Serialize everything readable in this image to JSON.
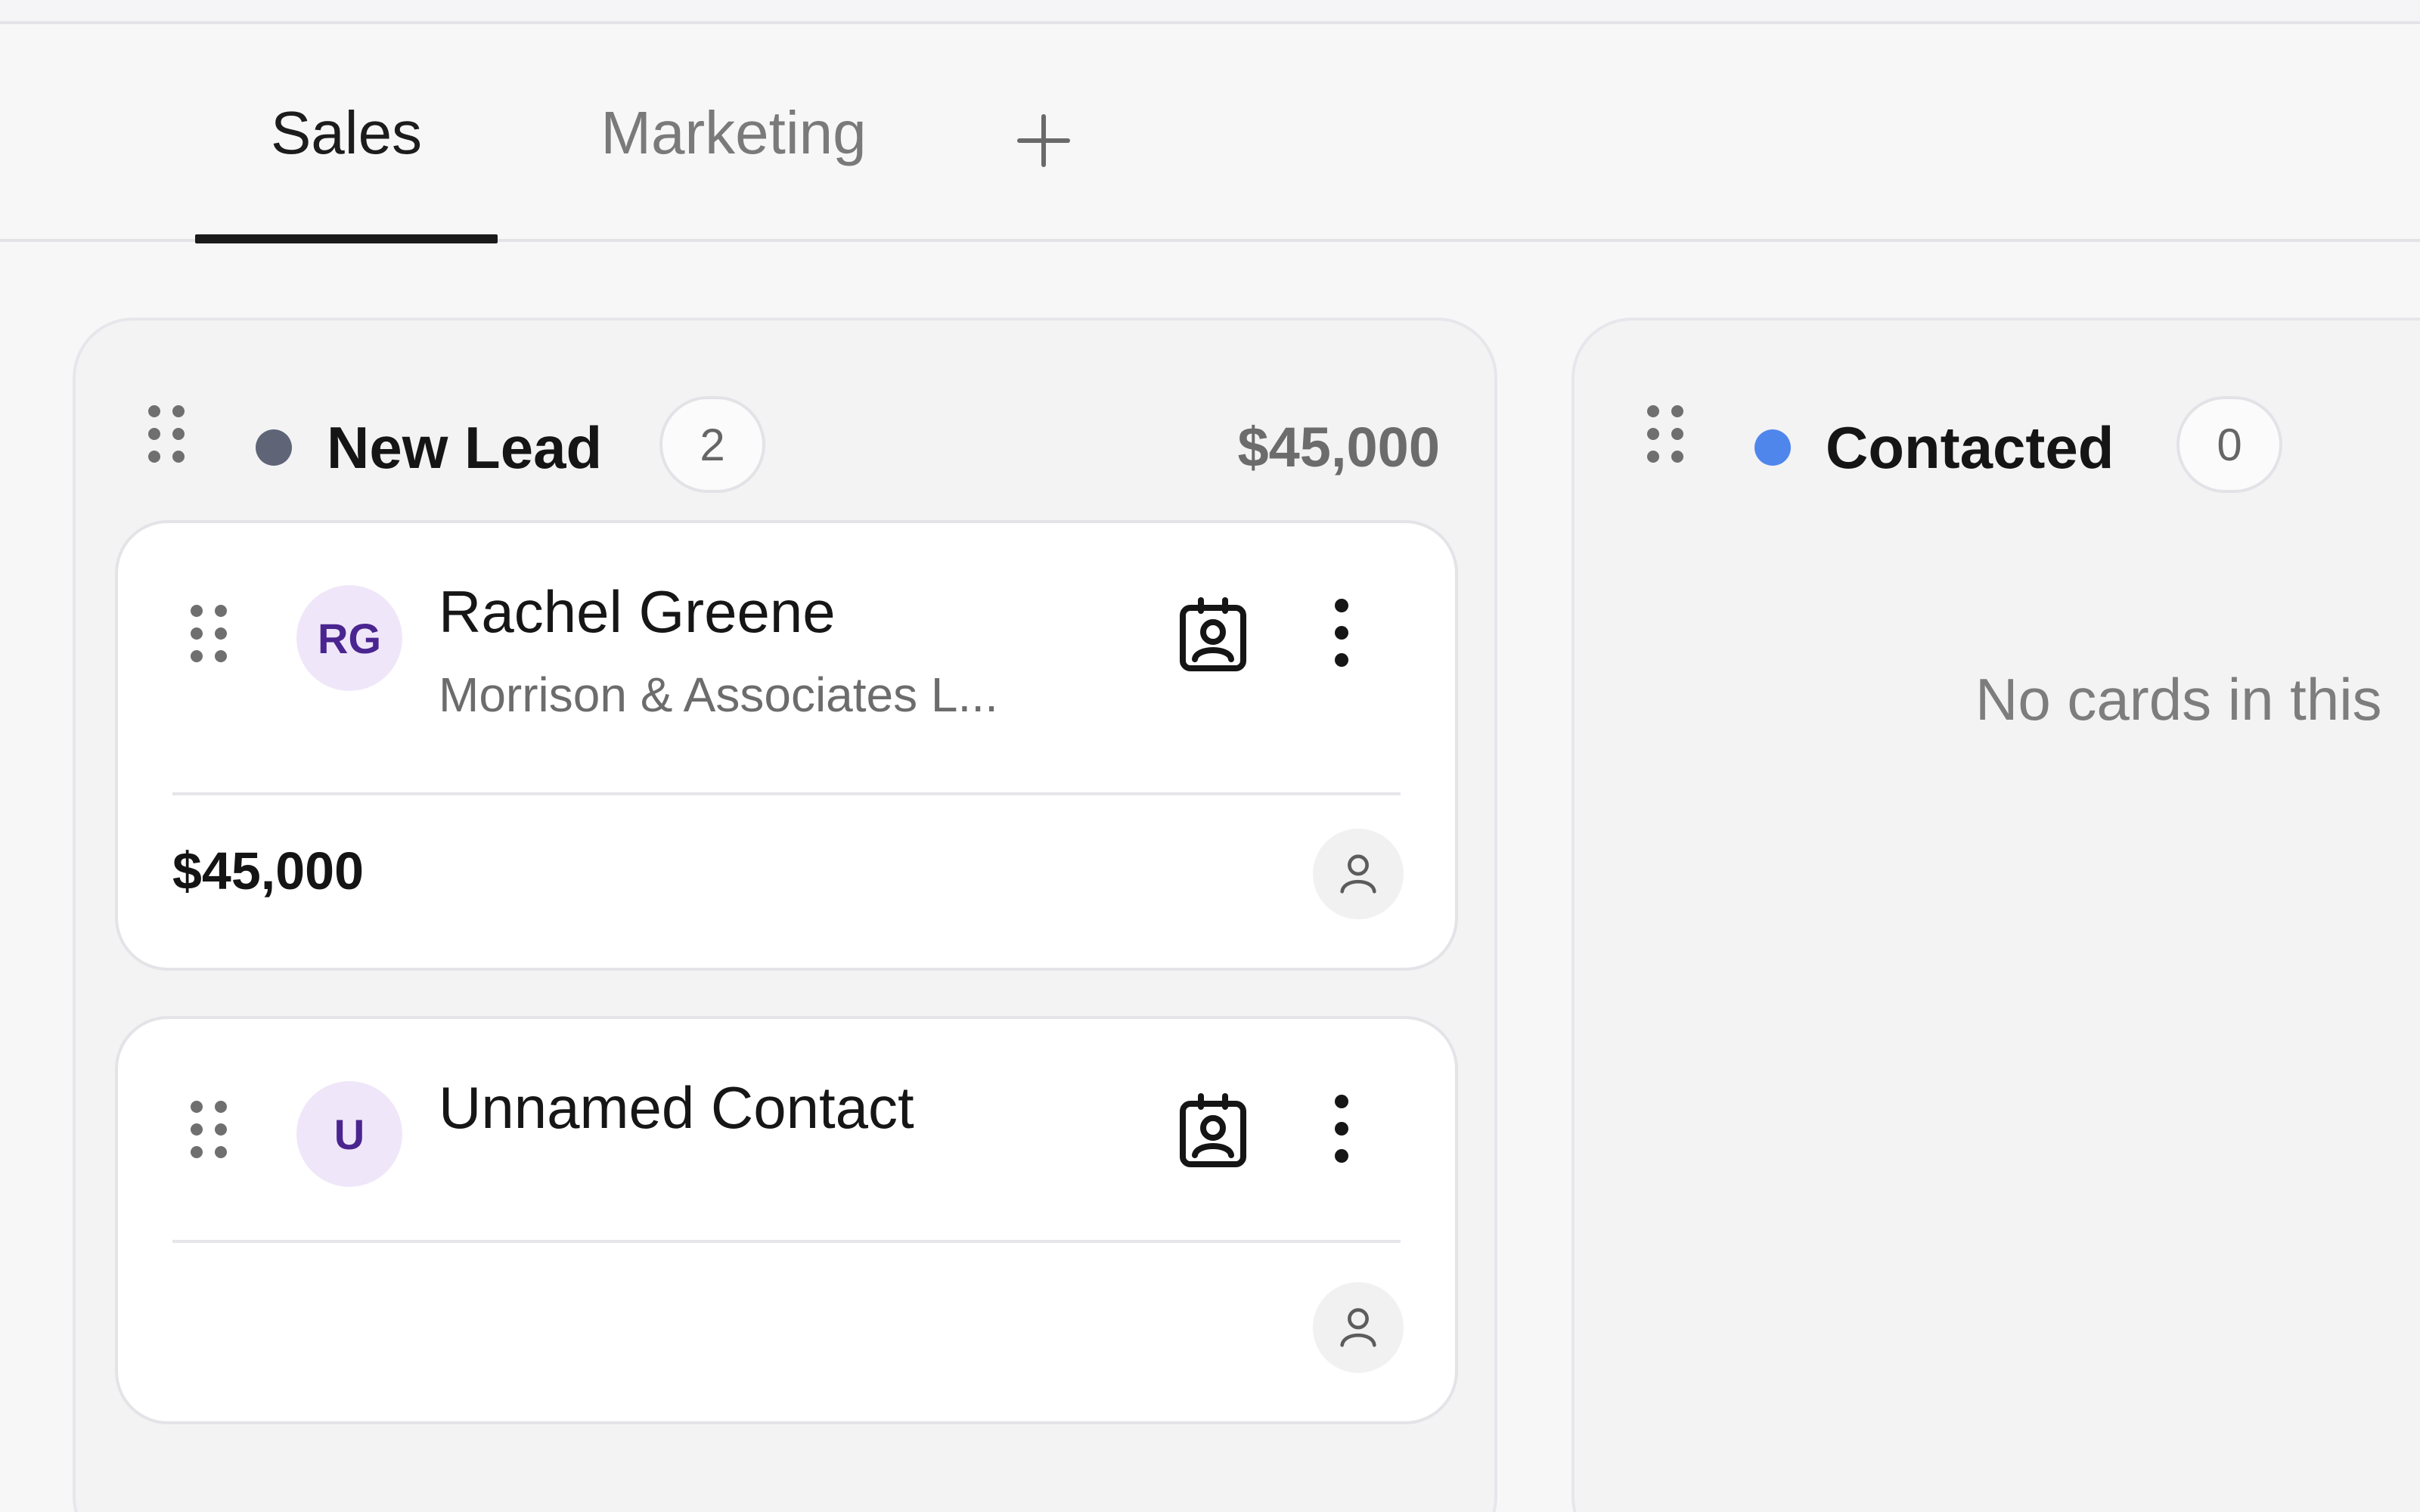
{
  "tabs": [
    {
      "label": "Sales",
      "active": true
    },
    {
      "label": "Marketing",
      "active": false
    }
  ],
  "add_tab_icon": "plus-icon",
  "columns": [
    {
      "title": "New Lead",
      "count": "2",
      "total": "$45,000",
      "dot_color": "#5f6577",
      "cards": [
        {
          "initials": "RG",
          "name": "Rachel Greene",
          "company": "Morrison & Associates L...",
          "amount": "$45,000"
        },
        {
          "initials": "U",
          "name": "Unnamed Contact",
          "company": "",
          "amount": ""
        }
      ]
    },
    {
      "title": "Contacted",
      "count": "0",
      "dot_color": "#4f86ec",
      "empty_message": "No cards in this"
    }
  ],
  "colors": {
    "accent": "#1a1a1a",
    "avatar_bg": "#efe7f9",
    "avatar_text": "#4a2590"
  }
}
